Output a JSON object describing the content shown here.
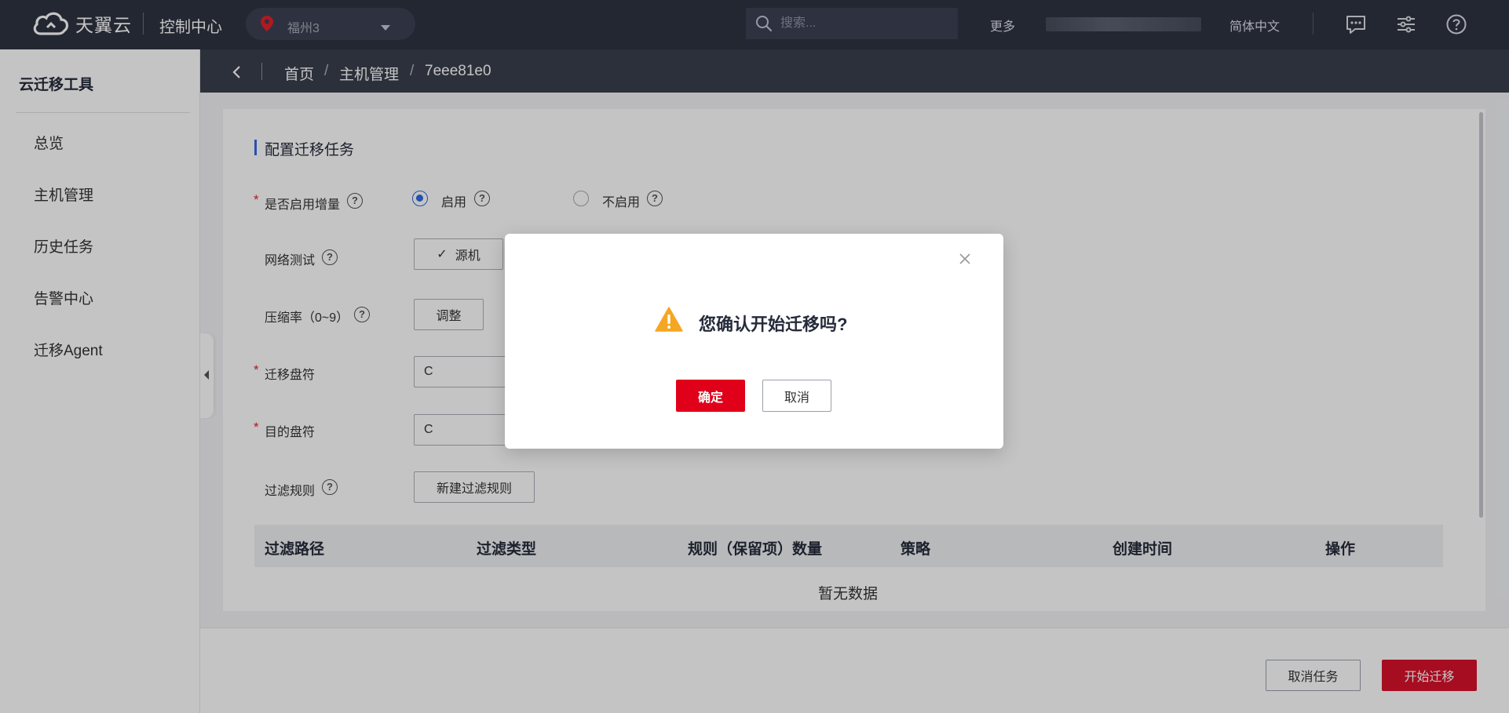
{
  "topbar": {
    "brand": "天翼云",
    "console_title": "控制中心",
    "region": "福州3",
    "search_placeholder": "搜索...",
    "more": "更多",
    "language": "简体中文",
    "icons": [
      "message-icon",
      "settings-sliders-icon",
      "help-icon"
    ]
  },
  "sidebar": {
    "title": "云迁移工具",
    "items": [
      {
        "label": "总览"
      },
      {
        "label": "主机管理"
      },
      {
        "label": "历史任务"
      },
      {
        "label": "告警中心"
      },
      {
        "label": "迁移Agent"
      }
    ]
  },
  "breadcrumb": {
    "items": [
      "首页",
      "主机管理",
      "7eee81e0"
    ],
    "separator": "/"
  },
  "form": {
    "section_title": "配置迁移任务",
    "incremental": {
      "label": "是否启用增量",
      "options": [
        {
          "label": "启用",
          "selected": true
        },
        {
          "label": "不启用",
          "selected": false
        }
      ]
    },
    "network_test": {
      "label": "网络测试",
      "button": "源机",
      "check_mark": "✓"
    },
    "compression": {
      "label": "压缩率（0~9）",
      "button": "调整"
    },
    "source_disk": {
      "label": "迁移盘符",
      "value": "C"
    },
    "target_disk": {
      "label": "目的盘符",
      "value": "C"
    },
    "filter_rules": {
      "label": "过滤规则",
      "button": "新建过滤规则"
    }
  },
  "table": {
    "columns": [
      "过滤路径",
      "过滤类型",
      "规则（保留项）数量",
      "策略",
      "创建时间",
      "操作"
    ],
    "rows": [],
    "empty_text": "暂无数据"
  },
  "footer": {
    "cancel_task": "取消任务",
    "start_migration": "开始迁移"
  },
  "dialog": {
    "message": "您确认开始迁移吗?",
    "confirm": "确定",
    "cancel": "取消"
  },
  "colors": {
    "topbar_bg": "#2e3341",
    "breadcrumb_bg": "#3a3f4c",
    "primary_red": "#e0001a",
    "accent_blue": "#2e6be6",
    "warning_orange": "#f5a623"
  }
}
